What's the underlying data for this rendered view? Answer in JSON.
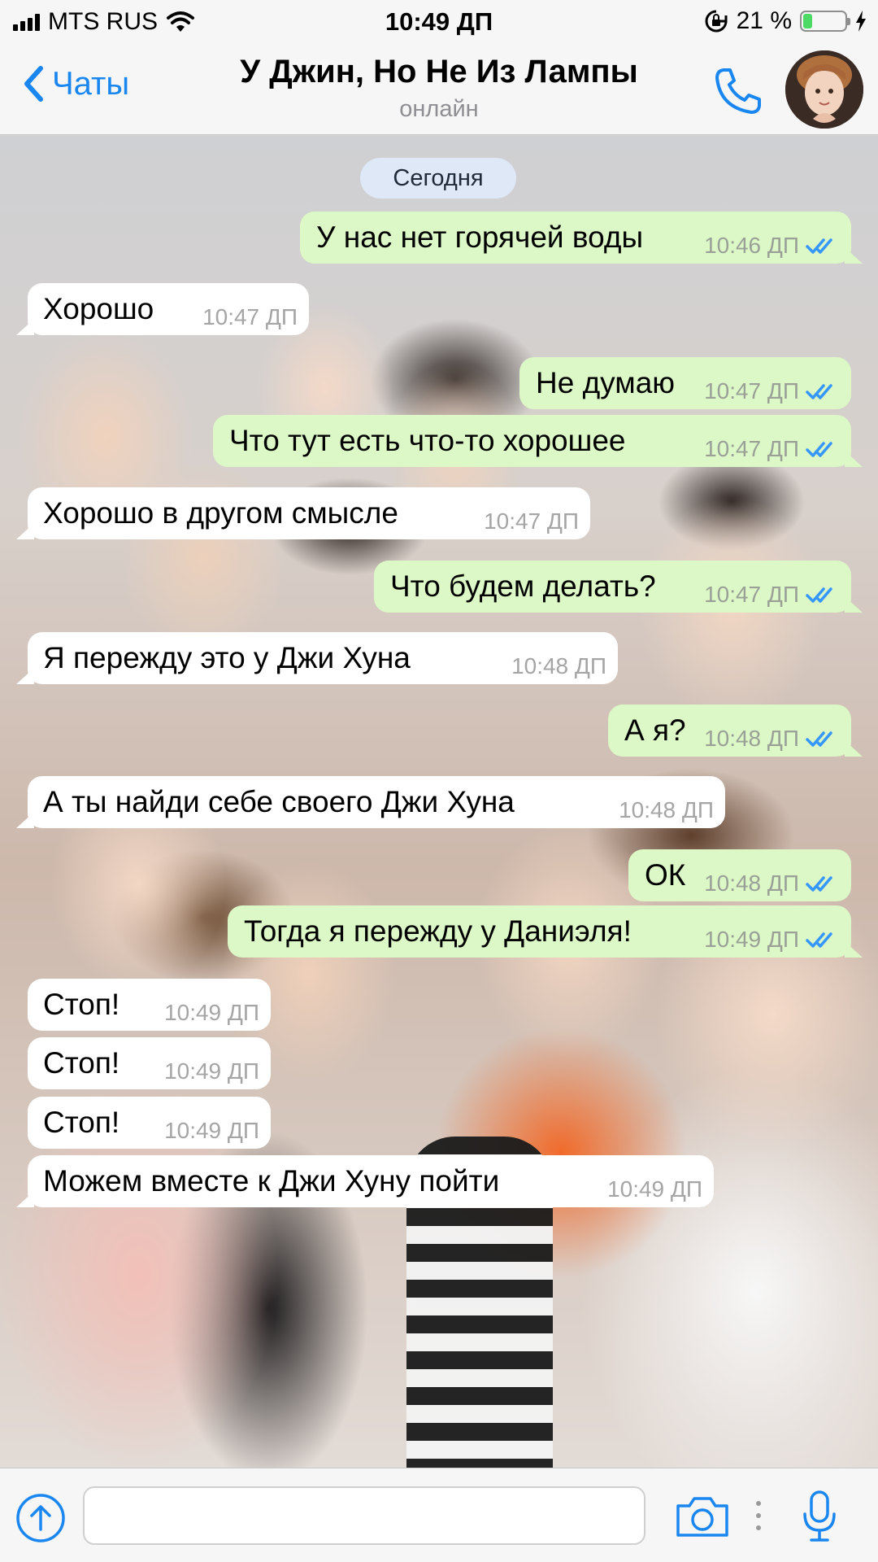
{
  "status_bar": {
    "carrier": "MTS RUS",
    "time": "10:49 ДП",
    "battery_percent": "21 %",
    "battery_level": 0.21
  },
  "header": {
    "back_label": "Чаты",
    "chat_title": "У Джин, Но Не Из Лампы",
    "status": "онлайн"
  },
  "chat": {
    "date_separator": "Сегодня",
    "messages": [
      {
        "direction": "out",
        "text": "У нас нет горячей воды",
        "time": "10:46 ДП",
        "read": true
      },
      {
        "direction": "in",
        "text": "Хорошо",
        "time": "10:47 ДП"
      },
      {
        "direction": "out",
        "text": "Не думаю",
        "time": "10:47 ДП",
        "read": true
      },
      {
        "direction": "out",
        "text": "Что тут есть что-то хорошее",
        "time": "10:47 ДП",
        "read": true
      },
      {
        "direction": "in",
        "text": "Хорошо в другом смысле",
        "time": "10:47 ДП"
      },
      {
        "direction": "out",
        "text": "Что будем делать?",
        "time": "10:47 ДП",
        "read": true
      },
      {
        "direction": "in",
        "text": "Я пережду это у Джи Хуна",
        "time": "10:48 ДП"
      },
      {
        "direction": "out",
        "text": "А я?",
        "time": "10:48 ДП",
        "read": true
      },
      {
        "direction": "in",
        "text": "А ты найди себе своего Джи Хуна",
        "time": "10:48 ДП"
      },
      {
        "direction": "out",
        "text": "ОК",
        "time": "10:48 ДП",
        "read": true
      },
      {
        "direction": "out",
        "text": "Тогда я пережду у Даниэля!",
        "time": "10:49 ДП",
        "read": true
      },
      {
        "direction": "in",
        "text": "Стоп!",
        "time": "10:49 ДП"
      },
      {
        "direction": "in",
        "text": "Стоп!",
        "time": "10:49 ДП"
      },
      {
        "direction": "in",
        "text": "Стоп!",
        "time": "10:49 ДП"
      },
      {
        "direction": "in",
        "text": "Можем вместе к Джи Хуну пойти",
        "time": "10:49 ДП"
      }
    ]
  },
  "input": {
    "message_value": "",
    "placeholder": ""
  },
  "colors": {
    "accent": "#1a86f0",
    "outgoing_bubble": "#dcf8c6",
    "incoming_bubble": "#ffffff",
    "read_ticks": "#3497f9",
    "date_pill": "#dfe8f7"
  },
  "icons": [
    "signal-icon",
    "wifi-icon",
    "rotation-lock-icon",
    "battery-icon",
    "charging-icon",
    "chevron-left-icon",
    "phone-icon",
    "upload-icon",
    "camera-icon",
    "more-dots-icon",
    "microphone-icon",
    "double-check-icon"
  ]
}
